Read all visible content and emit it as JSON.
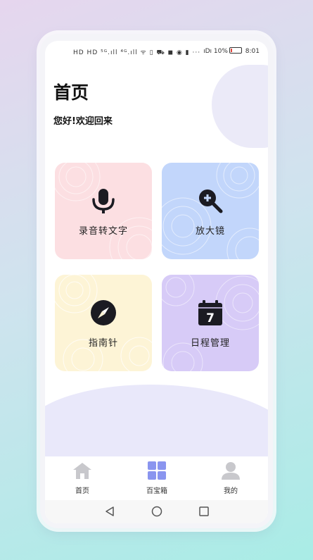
{
  "status_bar": {
    "left_icons": "HD HD ⁵ᴳ.ıll ⁴ᴳ.ıll ᯤ ▯ ⛟ ◼ ◉ ▮ ···",
    "right_icons": "ıDı 10%",
    "time": "8:01"
  },
  "header": {
    "title": "首页",
    "greeting": "您好!欢迎回来"
  },
  "cards": [
    {
      "label": "录音转文字",
      "icon": "microphone-icon",
      "color": "#fcdfe2"
    },
    {
      "label": "放大镜",
      "icon": "magnifier-plus-icon",
      "color": "#c2d6fb"
    },
    {
      "label": "指南针",
      "icon": "compass-icon",
      "color": "#fdf4d6"
    },
    {
      "label": "日程管理",
      "icon": "calendar-icon",
      "color": "#d7cbf7",
      "icon_text": "7"
    }
  ],
  "tabbar": {
    "items": [
      {
        "label": "首页",
        "icon": "home-icon",
        "active": false
      },
      {
        "label": "百宝箱",
        "icon": "grid-icon",
        "active": true
      },
      {
        "label": "我的",
        "icon": "user-icon",
        "active": false
      }
    ],
    "active_color": "#8a95ef",
    "inactive_color": "#c8c8cc"
  },
  "nav": {
    "back": "back-triangle-icon",
    "home": "home-circle-icon",
    "recents": "recents-square-icon"
  }
}
